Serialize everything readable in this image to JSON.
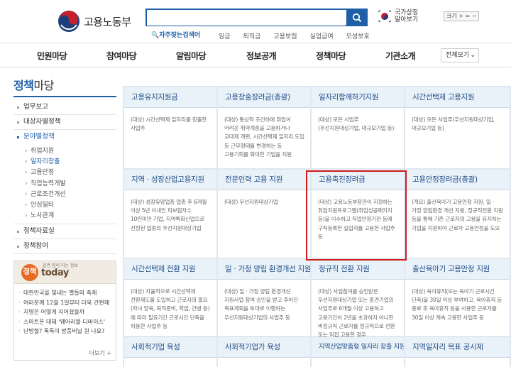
{
  "header": {
    "logo_text": "고용노동부",
    "search": {
      "value": "",
      "placeholder": ""
    },
    "flag_text": "국가상징\n알아보기",
    "size_control": "크기 + = −",
    "frequent_search": "자주찾는검색어",
    "quick_links": [
      "임금",
      "퇴직금",
      "고용보험",
      "실업급여",
      "모성보호"
    ]
  },
  "gnb": {
    "items": [
      "민원마당",
      "참여마당",
      "알림마당",
      "정보공개",
      "정책마당",
      "기관소개"
    ],
    "all_view": "전체보기"
  },
  "lnb": {
    "title_blue": "정책",
    "title_dark": "마당",
    "menu_top": [
      "업무보고",
      "대상자별정책"
    ],
    "menu_active": "분야별정책",
    "submenu": [
      "취업지원",
      "일자리창출",
      "고용안정",
      "직업능력개발",
      "근로조건개선",
      "안심일터",
      "노사관계"
    ],
    "submenu_active_index": 1,
    "menu_bottom": [
      "정책자료실",
      "정책참여"
    ]
  },
  "today": {
    "tag": "알면 힘이 되는 정보",
    "logo": "정책",
    "word": "today",
    "items": [
      "대한민국을 빛내는 별들의 축제",
      "여러분께 12월 1일부터 더욱 간편해",
      "지명은 어떻게 지어졌을까",
      "스마트폰 대체 '웨어러블 디바이스'",
      "난방철? 톡톡이 방풍비닐 원 나요?"
    ],
    "more": "더보기 +"
  },
  "cards": [
    {
      "title": "고용유지지원금",
      "desc": "(대상) 시간선택제 일자리를 창출한 사업주"
    },
    {
      "title": "고용창출장려금(총괄)",
      "desc": "(대상) 통상적 조건하에 취업이 어려운 취약계층을 고용하거나 교대제 개편, 시간선택제 일자리 도입 등 근무형태를 변경하는 등 고용기회를 확대한 기업을 지원"
    },
    {
      "title": "일자리함께하기지원",
      "desc": "(대상) 모든 사업주(우선지원대상기업, 대규모기업 등)"
    },
    {
      "title": "시간선택제 고용지원",
      "desc": "(대상) 모든 사업주(우선지원대상기업, 대규모기업 등)"
    },
    {
      "title": "지역 · 성장산업고용지원",
      "desc": "(대상) 성장유망업종 업종 후 6개월 이상 5년 이내인 피보험자수 10인미만 기업, 지역특화산업으로 선정된 업종의 우선지원대상기업"
    },
    {
      "title": "전문인력 고용 지원",
      "desc": "(대상) 우선지원대상기업"
    },
    {
      "title": "고용촉진장려금",
      "desc": "(대상) 고용노동부장관이 지정하는 취업지원프로그램(취업성공패키지 등)을 이수하고 직업안정기관 등에 구직등록한 실업자를 고용한 사업주 등"
    },
    {
      "title": "고용안정장려금(총괄)",
      "desc": "(개요) 출산육아기 고용안정 지원, 일 · 가정 양립환경 개선 지원, 정규직전환 지원 등을 통해 기존 근로자의 고용을 유지하는 기업을 지원하여 근로자 고용안정을 도모"
    },
    {
      "title": "시간선택제 전환 지원",
      "desc": "(대상) 자율적으로 시간선택제 전환제도를 도입하고 근로자의 필요(자녀 양육, 퇴직준비, 학업, 간병 등)에 따라 필요기간 근로시간 단축을 허용한 사업주 등"
    },
    {
      "title": "일 · 가정 양립 환경개선 지원",
      "desc": "(대상) 일 · 가정 양립 환경개선 지원사업 참여 승인을 받고 주어진 목표계획을 토대로 이행하는 우선지원대상기업의 사업주 등"
    },
    {
      "title": "정규직 전환 지원",
      "desc": "(대상) 사업참여를 승인받은 우선지원대상기업 또는 중견기업의 사업주로 6개월 이상 고용하고 고용기간이 2년을 초과하지 아니한 비정규직 근로자를 정규직으로 전환 또는 직접 고용한 경우"
    },
    {
      "title": "출산육아기 고용안정 지원",
      "desc": "(대상) 육아휴직(또는 육아기 근로시간 단축)을 30일 이상 부여하고, 육아휴직 등 종료 후 육아휴직 등을 사용한 근로자를 30일 이상 계속 고용한 사업주 등"
    },
    {
      "title": "사회적기업 육성",
      "desc": ""
    },
    {
      "title": "사회적기업가 육성",
      "desc": ""
    },
    {
      "title": "지역산업맞춤형 일자리 창출 지원",
      "desc": ""
    },
    {
      "title": "지역일자리 목표 공시제",
      "desc": ""
    }
  ],
  "colors": {
    "brand_blue": "#1e5fa8",
    "highlight_red": "#d11a1a",
    "card_header": "#eaf2f9"
  }
}
